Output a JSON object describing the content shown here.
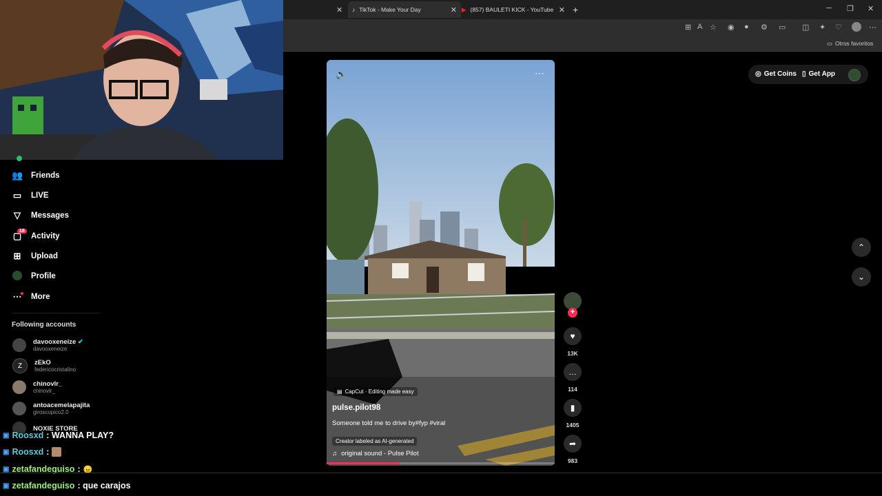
{
  "tabs": [
    {
      "label": "TikTok - Make Your Day",
      "icon": "tiktok-icon"
    },
    {
      "label": "(857) BAULETI KICK - YouTube",
      "icon": "youtube-icon"
    }
  ],
  "new_tab_label": "+",
  "bookmarks": {
    "other_favorites": "Otros favoritos"
  },
  "sidebar": {
    "items": [
      {
        "label": "Friends",
        "icon": "friends-icon"
      },
      {
        "label": "LIVE",
        "icon": "live-icon"
      },
      {
        "label": "Messages",
        "icon": "messages-icon"
      },
      {
        "label": "Activity",
        "icon": "activity-icon",
        "badge": "18"
      },
      {
        "label": "Upload",
        "icon": "upload-icon"
      },
      {
        "label": "Profile",
        "icon": "profile-icon"
      },
      {
        "label": "More",
        "icon": "more-icon"
      }
    ],
    "following_title": "Following accounts",
    "accounts": [
      {
        "name": "davooxeneize",
        "handle": "davooxeneize",
        "verified": true
      },
      {
        "name": "zEkO",
        "handle": "federicocristalino"
      },
      {
        "name": "chinovlr_",
        "handle": "chinovlr_"
      },
      {
        "name": "antoacemelapajita",
        "handle": "giroscopico2.0"
      },
      {
        "name": "NOXIE STORE",
        "handle": ""
      }
    ]
  },
  "chat": [
    {
      "user": "Roosxd",
      "message": ": WANNA PLAY?"
    },
    {
      "user": "Roosxd",
      "message": ":"
    },
    {
      "user": "zetafandeguiso",
      "message": ":"
    },
    {
      "user": "zetafandeguiso",
      "message": ": que carajos"
    }
  ],
  "video": {
    "effect": "CapCut · Editing made easy",
    "author": "pulse.pilot98",
    "caption": "Someone told me to drive by#fyp #viral",
    "ai_label": "Creator labeled as AI-generated",
    "sound": "original sound - Pulse Pilot",
    "progress": 0.32
  },
  "actions": {
    "likes": "13K",
    "comments": "114",
    "saves": "1405",
    "shares": "983"
  },
  "header": {
    "get_coins": "Get Coins",
    "get_app": "Get App"
  },
  "colors": {
    "accent": "#fe2c55",
    "chat_user_1": "#5ec8d8",
    "chat_user_2": "#9bf07b"
  }
}
